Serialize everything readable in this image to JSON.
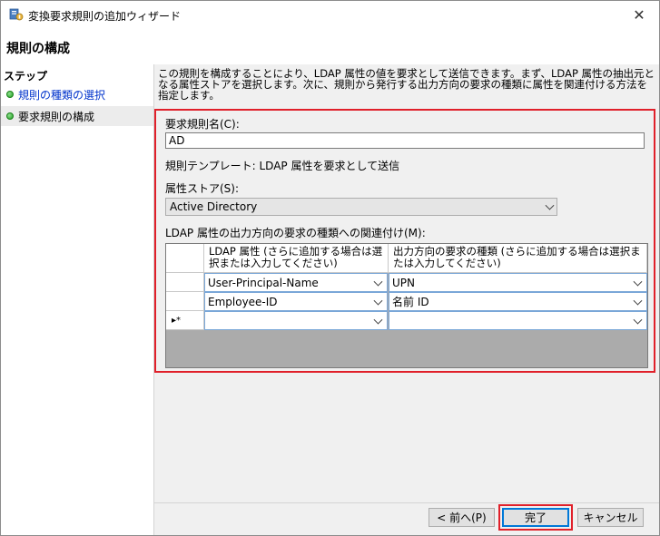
{
  "window": {
    "title": "変換要求規則の追加ウィザード",
    "close_glyph": "✕"
  },
  "page": {
    "title": "規則の構成"
  },
  "steps": {
    "header": "ステップ",
    "items": [
      {
        "label": "規則の種類の選択",
        "state": "link"
      },
      {
        "label": "要求規則の構成",
        "state": "current"
      }
    ]
  },
  "content": {
    "description": "この規則を構成することにより、LDAP 属性の値を要求として送信できます。まず、LDAP 属性の抽出元となる属性ストアを選択します。次に、規則から発行する出力方向の要求の種類に属性を関連付ける方法を指定します。",
    "rule_name_label": "要求規則名(C):",
    "rule_name_value": "AD",
    "template_text": "規則テンプレート: LDAP 属性を要求として送信",
    "attribute_store_label": "属性ストア(S):",
    "attribute_store_value": "Active Directory",
    "mapping_label": "LDAP 属性の出力方向の要求の種類への関連付け(M):",
    "mapping_table": {
      "columns": [
        "LDAP 属性 (さらに追加する場合は選択または入力してください)",
        "出力方向の要求の種類 (さらに追加する場合は選択または入力してください)"
      ],
      "rows": [
        {
          "marker": "",
          "ldap": "User-Principal-Name",
          "claim": "UPN"
        },
        {
          "marker": "",
          "ldap": "Employee-ID",
          "claim": "名前 ID"
        },
        {
          "marker": "▸*",
          "ldap": "",
          "claim": ""
        }
      ]
    }
  },
  "buttons": {
    "back": "< 前へ(P)",
    "finish": "完了",
    "cancel": "キャンセル"
  },
  "colors": {
    "highlight_red": "#e0202a",
    "link_blue": "#0033cc",
    "focus_blue": "#0078d7"
  },
  "icons": {
    "app": "adfs-wizard-icon",
    "close": "close-icon",
    "step": "green-dot-icon",
    "dropdown": "chevron-down-icon"
  }
}
